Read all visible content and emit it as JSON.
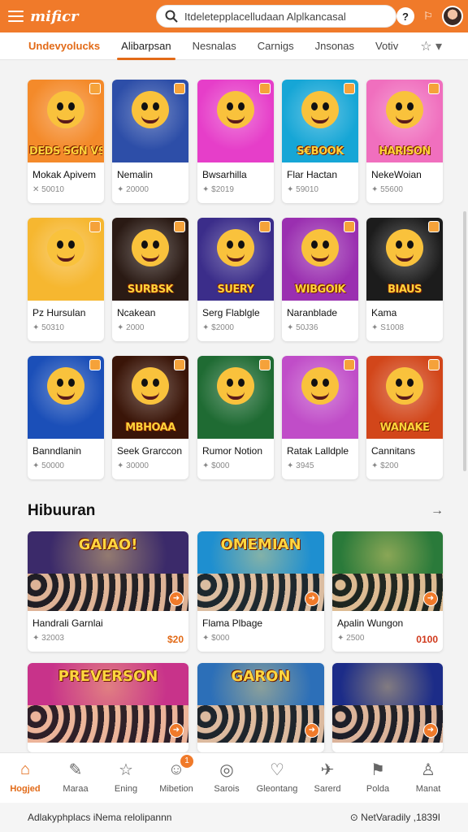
{
  "header": {
    "logo": "mificr",
    "search_value": "Itdeletepplacelludaan Alplkancasal",
    "help_label": "?",
    "notif_label": "⚐"
  },
  "tabs": [
    "Undevyolucks",
    "Alibarpsan",
    "Nesnalas",
    "Carnigs",
    "Jnsonas",
    "Votiv"
  ],
  "games": [
    {
      "title": "Mokak Apivem",
      "meta": "✕ 50010",
      "banner": "DEDS SGN VSCAN",
      "bg": "#f48a2a"
    },
    {
      "title": "Nemalin",
      "meta": "✦ 20000",
      "banner": "",
      "bg": "#2d4ea8"
    },
    {
      "title": "Bwsarhilla",
      "meta": "✦ $2019",
      "banner": "",
      "bg": "#e63ec9"
    },
    {
      "title": "Flar Hactan",
      "meta": "✦ 59010",
      "banner": "S€BOOK",
      "bg": "#16a6d6"
    },
    {
      "title": "NekeWoian",
      "meta": "✦ 55600",
      "banner": "HARISON",
      "bg": "#f06fbe"
    },
    {
      "title": "Pz Hursulan",
      "meta": "✦ 50310",
      "banner": "",
      "bg": "#f6b730"
    },
    {
      "title": "Ncakean",
      "meta": "✦ 2000",
      "banner": "SURBSK",
      "bg": "#2a1a14"
    },
    {
      "title": "Serg Flablgle",
      "meta": "✦ $2000",
      "banner": "SUERY",
      "bg": "#3b2d8a"
    },
    {
      "title": "Naranblade",
      "meta": "✦ 50J36",
      "banner": "WIBGOIK",
      "bg": "#9a2fb0"
    },
    {
      "title": "Kama",
      "meta": "✦ S1008",
      "banner": "BIAUS",
      "bg": "#1c1c1c"
    },
    {
      "title": "Banndlanin",
      "meta": "✦ 50000",
      "banner": "",
      "bg": "#1b4fb8"
    },
    {
      "title": "Seek Grarccon",
      "meta": "✦ 30000",
      "banner": "MBHOAA",
      "bg": "#3a1508"
    },
    {
      "title": "Rumor Notion",
      "meta": "✦ $000",
      "banner": "",
      "bg": "#1f6b33"
    },
    {
      "title": "Ratak Lalldple",
      "meta": "✦ 3945",
      "banner": "",
      "bg": "#c04dc8"
    },
    {
      "title": "Cannitans",
      "meta": "✦ $200",
      "banner": "WANAKE",
      "bg": "#d2461a"
    }
  ],
  "section": {
    "title": "Hibuuran",
    "arrow": "→"
  },
  "features": [
    {
      "title": "Handrali Garnlai",
      "meta": "✦ 32003",
      "price": "$20",
      "banner": "GAIAO!",
      "bg": "#3b2a6a"
    },
    {
      "title": "Flama Plbage",
      "meta": "✦ $000",
      "price": "",
      "banner": "OMEMIAN",
      "bg": "#1e8fd0"
    },
    {
      "title": "Apalin Wungon",
      "meta": "✦ 2500",
      "price": "0100",
      "banner": "",
      "bg": "#2a7a3a"
    },
    {
      "title": "",
      "meta": "",
      "price": "",
      "banner": "PREVERSON",
      "bg": "#c8338a"
    },
    {
      "title": "",
      "meta": "",
      "price": "",
      "banner": "GARON",
      "bg": "#2c6fb8"
    },
    {
      "title": "",
      "meta": "",
      "price": "",
      "banner": "",
      "bg": "#1c2c88"
    }
  ],
  "nav": [
    {
      "label": "Hogjed",
      "icon": "⌂"
    },
    {
      "label": "Maraa",
      "icon": "✎"
    },
    {
      "label": "Ening",
      "icon": "☆"
    },
    {
      "label": "Mibetion",
      "icon": "☺",
      "badge": "1"
    },
    {
      "label": "Sarois",
      "icon": "◎"
    },
    {
      "label": "Gleontang",
      "icon": "♡"
    },
    {
      "label": "Sarerd",
      "icon": "✈"
    },
    {
      "label": "Polda",
      "icon": "⚑"
    },
    {
      "label": "Manat",
      "icon": "♙"
    }
  ],
  "footer": {
    "left": "Adlakyphplacs iNema relolipannn",
    "right": "NetVaradily ,1839I"
  }
}
